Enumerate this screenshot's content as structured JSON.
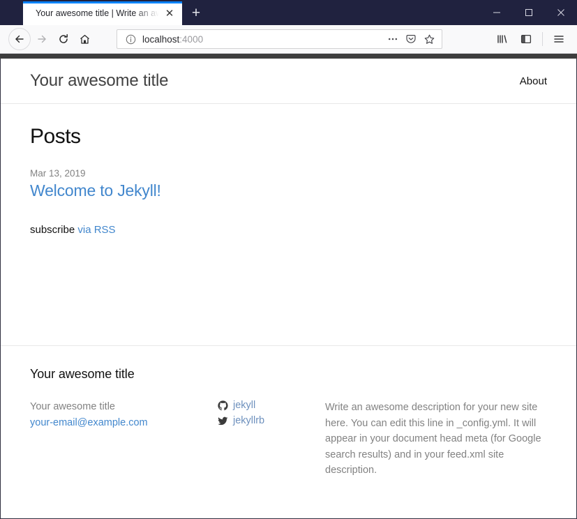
{
  "browser": {
    "tab": {
      "title": "Your awesome title | Write an awesome description for your new site here. You can edit this line in _config.yml. It will appear in your document head meta (for Google search results) and in your feed.xml site description.",
      "close_label": "✕"
    },
    "new_tab_label": "+",
    "window_controls": {
      "minimize": "Minimize",
      "maximize": "Maximize",
      "close": "Close"
    },
    "nav": {
      "back": "Back",
      "forward": "Forward",
      "reload": "Reload",
      "home": "Home"
    },
    "urlbar": {
      "identity_icon": "info-icon",
      "host": "localhost",
      "port": ":4000",
      "page_actions": "…",
      "pocket": "Save to Pocket",
      "bookmark": "Bookmark this page"
    },
    "toolbar_right": {
      "library": "Library",
      "sidebar": "Sidebar",
      "menu": "Open menu"
    },
    "colors": {
      "titlebar": "#20223f",
      "tab_accent": "#0a84ff",
      "toolbar": "#f9f9fa"
    }
  },
  "site": {
    "header": {
      "title": "Your awesome title",
      "nav": [
        {
          "label": "About"
        }
      ]
    },
    "main": {
      "heading": "Posts",
      "posts": [
        {
          "date": "Mar 13, 2019",
          "title": "Welcome to Jekyll!"
        }
      ],
      "subscribe": {
        "text": "subscribe",
        "link_label": "via RSS"
      }
    },
    "footer": {
      "heading": "Your awesome title",
      "contact": [
        {
          "type": "text",
          "label": "Your awesome title"
        },
        {
          "type": "link",
          "label": "your-email@example.com"
        }
      ],
      "social": [
        {
          "icon": "github-icon",
          "label": "jekyll"
        },
        {
          "icon": "twitter-icon",
          "label": "jekyllrb"
        }
      ],
      "description": "Write an awesome description for your new site here. You can edit this line in _config.yml. It will appear in your document head meta (for Google search results) and in your feed.xml site description."
    },
    "colors": {
      "link": "#4287cd",
      "muted_text": "#828282",
      "body_text": "#111111"
    }
  }
}
